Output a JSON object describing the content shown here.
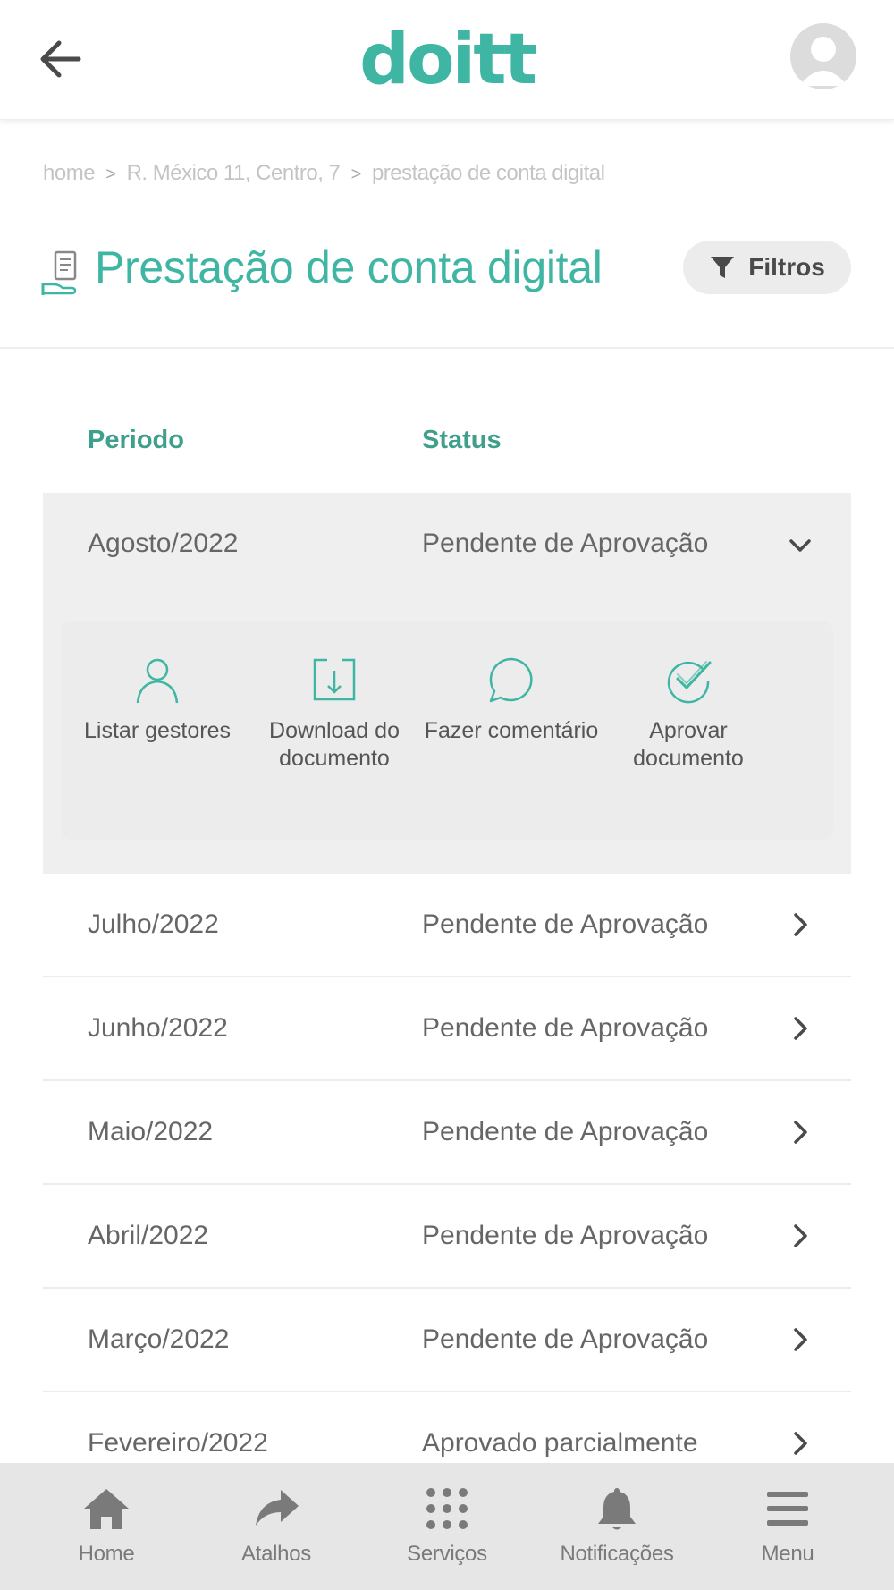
{
  "header": {
    "logo": "doitt"
  },
  "breadcrumb": {
    "items": [
      "home",
      "R. México 11, Centro, 7",
      "prestação de conta digital"
    ],
    "separator": ">"
  },
  "page": {
    "title": "Prestação de conta digital",
    "filter_label": "Filtros"
  },
  "table": {
    "col_period": "Periodo",
    "col_status": "Status",
    "expanded": {
      "period": "Agosto/2022",
      "status": "Pendente de Aprovação",
      "actions": [
        {
          "label": "Listar gestores",
          "icon": "user-icon"
        },
        {
          "label": "Download do documento",
          "icon": "download-icon"
        },
        {
          "label": "Fazer comentário",
          "icon": "comment-icon"
        },
        {
          "label": "Aprovar documento",
          "icon": "check-badge-icon"
        }
      ]
    },
    "rows": [
      {
        "period": "Julho/2022",
        "status": "Pendente de Aprovação"
      },
      {
        "period": "Junho/2022",
        "status": "Pendente de Aprovação"
      },
      {
        "period": "Maio/2022",
        "status": "Pendente de Aprovação"
      },
      {
        "period": "Abril/2022",
        "status": "Pendente de Aprovação"
      },
      {
        "period": "Março/2022",
        "status": "Pendente de Aprovação"
      },
      {
        "period": "Fevereiro/2022",
        "status": "Aprovado parcialmente"
      }
    ]
  },
  "bottom_nav": [
    {
      "label": "Home",
      "icon": "home-icon"
    },
    {
      "label": "Atalhos",
      "icon": "share-arrow-icon"
    },
    {
      "label": "Serviços",
      "icon": "grid-dots-icon"
    },
    {
      "label": "Notificações",
      "icon": "bell-icon"
    },
    {
      "label": "Menu",
      "icon": "hamburger-icon"
    }
  ],
  "colors": {
    "brand": "#3fb5a4",
    "header_text": "#3f9f8d",
    "expanded_bg": "#efefef",
    "nav_bg": "#e6e6e6"
  }
}
